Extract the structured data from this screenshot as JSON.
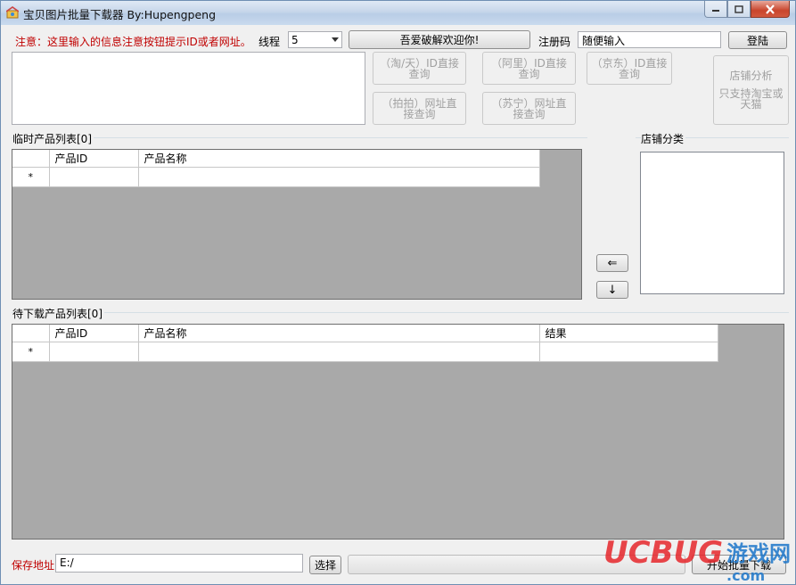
{
  "window": {
    "title": "宝贝图片批量下载器 By:Hupengpeng"
  },
  "toolbar": {
    "notice": "注意：这里输入的信息注意按钮提示ID或者网址。",
    "threads_label": "线程",
    "threads_value": "5",
    "banner_button": "吾爱破解欢迎你!",
    "reg_label": "注册码",
    "reg_value": "随便输入",
    "login_button": "登陆"
  },
  "query_buttons": {
    "taobao": [
      "（淘/天）ID直接",
      "查询"
    ],
    "ali": [
      "（阿里）ID直接",
      "查询"
    ],
    "jd": [
      "（京东）ID直接",
      "查询"
    ],
    "paipai": [
      "（拍拍）网址直",
      "接查询"
    ],
    "suning": [
      "（苏宁）网址直",
      "接查询"
    ],
    "shop_analysis": [
      "店铺分析",
      "",
      "只支持淘宝或",
      "天猫"
    ]
  },
  "temp_list": {
    "title": "临时产品列表[0]",
    "columns": [
      "产品ID",
      "产品名称"
    ],
    "new_row_marker": "*"
  },
  "shop_category": {
    "title": "店铺分类"
  },
  "move_buttons": {
    "left": "⇐",
    "down": "↓"
  },
  "download_list": {
    "title": "待下载产品列表[0]",
    "columns": [
      "产品ID",
      "产品名称",
      "结果"
    ],
    "new_row_marker": "*"
  },
  "footer": {
    "save_label": "保存地址",
    "save_path": "E:/",
    "choose_button": "选择",
    "start_button": "开始批量下载"
  },
  "watermark": {
    "brand": "UCBUG",
    "suffix": "游戏网",
    "domain": ".com"
  },
  "colors": {
    "notice_red": "#c00000",
    "grid_background": "#a9a9a9",
    "watermark_red": "#e5262a",
    "watermark_blue": "#1a74c9"
  }
}
